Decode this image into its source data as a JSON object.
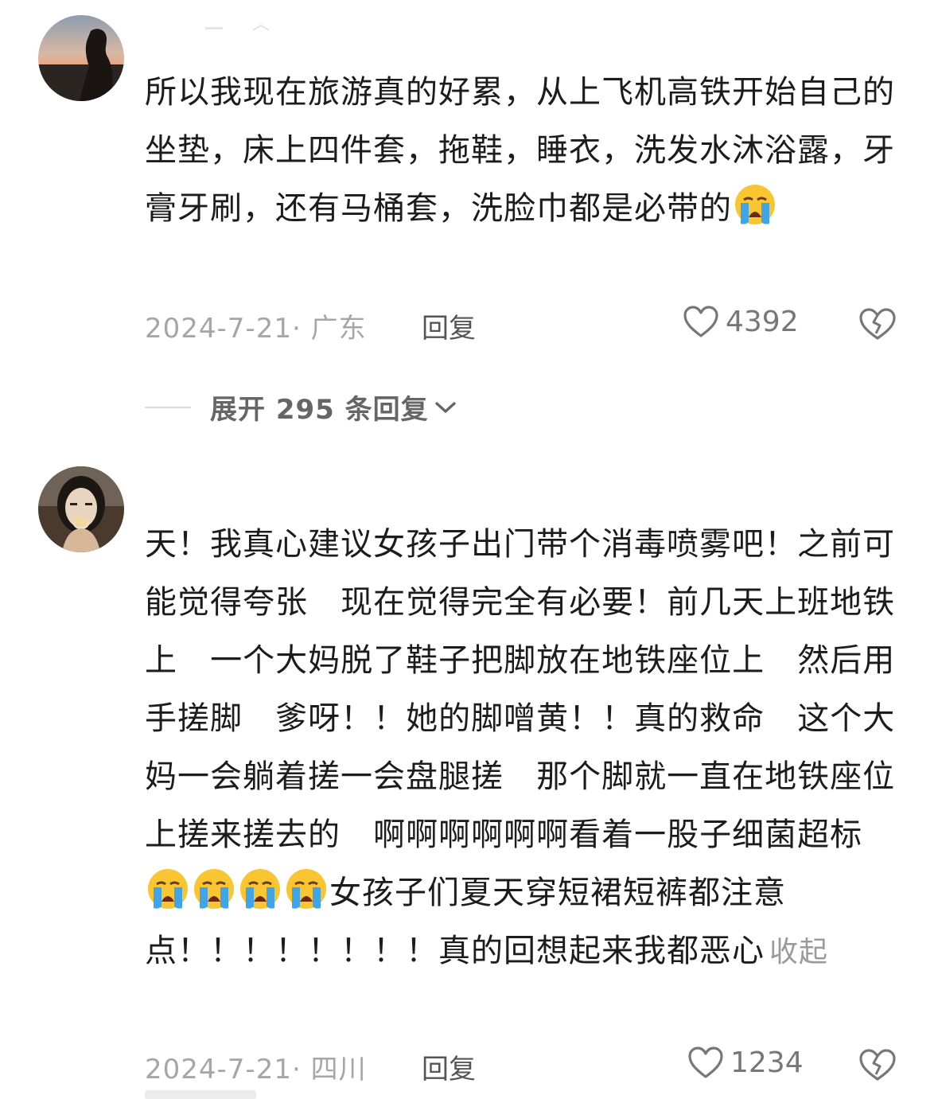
{
  "comments": [
    {
      "avatar_icon": "avatar-sunset-silhouette",
      "text_before_emoji": "所以我现在旅游真的好累，从上飞机高铁开始自己的坐垫，床上四件套，拖鞋，睡衣，洗发水沐浴露，牙膏牙刷，还有马桶套，洗脸巾都是必带的",
      "emoji_icon": "crying-face-emoji",
      "meta": "2024-7-21· 广东",
      "reply_label": "回复",
      "likes": "4392",
      "like_icon": "heart-outline-icon",
      "dislike_icon": "broken-heart-icon",
      "expand_label": "展开 295 条回复"
    },
    {
      "avatar_icon": "avatar-woman-portrait",
      "text_part1": "天！我真心建议女孩子出门带个消毒喷雾吧！之前可能觉得夸张   现在觉得完全有必要！前几天上班地铁上   一个大妈脱了鞋子把脚放在地铁座位上   然后用手搓脚   爹呀！！她的脚噌黄！！真的救命   这个大妈一会躺着搓一会盘腿搓   那个脚就一直在地铁座位上搓来搓去的   啊啊啊啊啊啊看着一股子细菌超标",
      "emoji_icon": "crying-face-emoji",
      "text_part2": "女孩子们夏天穿短裙短裤都注意点！！！！！！！！真的回想起来我都恶心",
      "collapse_label": "收起",
      "meta": "2024-7-21· 四川",
      "reply_label": "回复",
      "likes": "1234",
      "like_icon": "heart-outline-icon",
      "dislike_icon": "broken-heart-icon"
    }
  ],
  "colors": {
    "text": "#1c1c1c",
    "meta": "#a6a6a6",
    "icon": "#777777"
  }
}
